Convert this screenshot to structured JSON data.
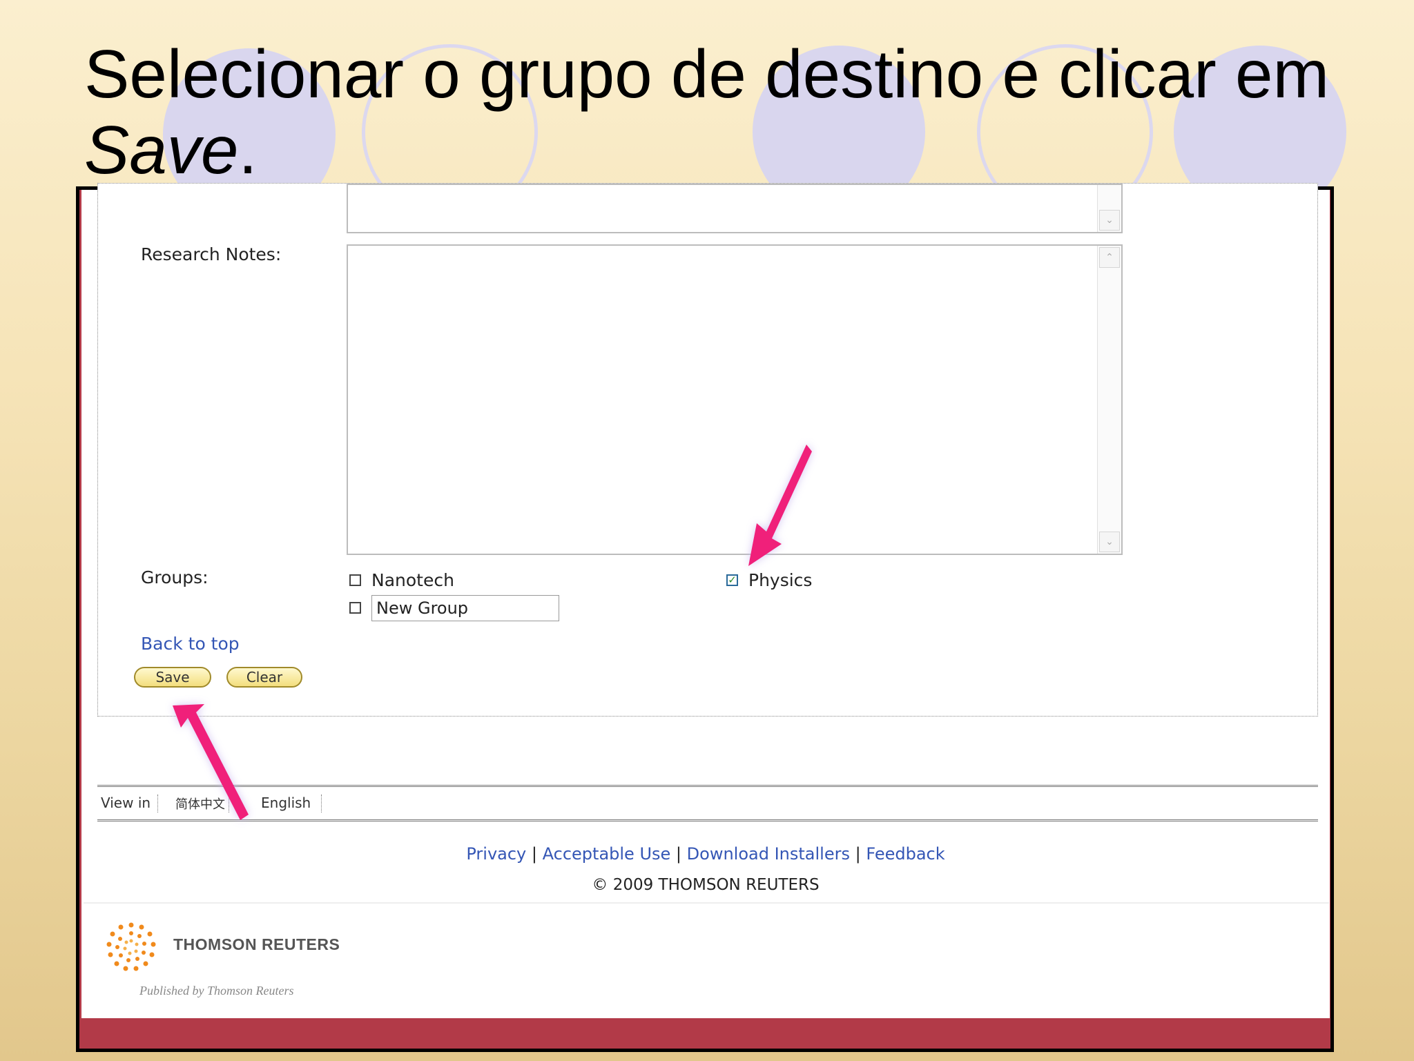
{
  "slide": {
    "title_text": "Selecionar o grupo de destino e clicar em",
    "title_emph": "Save",
    "title_end": "."
  },
  "form": {
    "research_notes_label": "Research Notes:",
    "groups_label": "Groups:",
    "groups": [
      {
        "label": "Nanotech",
        "checked": false
      },
      {
        "label": "Physics",
        "checked": true
      }
    ],
    "new_group_value": "New Group",
    "back_to_top": "Back to top",
    "save_label": "Save",
    "clear_label": "Clear"
  },
  "language_bar": {
    "view_in": "View in",
    "chinese": "简体中文",
    "english": "English"
  },
  "footer": {
    "links": [
      "Privacy",
      "Acceptable Use",
      "Download Installers",
      "Feedback"
    ],
    "separator": "|",
    "copyright": "© 2009 THOMSON REUTERS",
    "logo_text": "THOMSON REUTERS",
    "published": "Published by Thomson Reuters"
  },
  "colors": {
    "link": "#3456b5",
    "arrow": "#f0207a",
    "frame_red": "#b23a48"
  },
  "icons": [
    "scroll-up-icon",
    "scroll-down-icon",
    "checkbox-icon",
    "checkmark-icon",
    "pink-arrow-icon",
    "thomson-reuters-logo-icon"
  ]
}
